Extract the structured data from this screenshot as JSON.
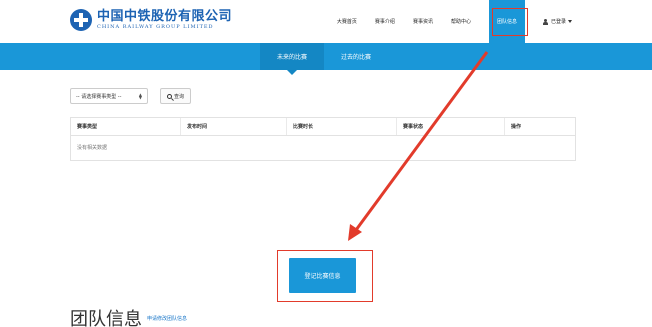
{
  "logo": {
    "cn": "中国中铁股份有限公司",
    "en": "CHINA RAILWAY GROUP LIMITED"
  },
  "nav": {
    "items": [
      {
        "label": "大赛首页"
      },
      {
        "label": "赛事介绍"
      },
      {
        "label": "赛事资讯"
      },
      {
        "label": "帮助中心"
      },
      {
        "label": "团队信息",
        "active": true
      }
    ],
    "user_label": "已登录"
  },
  "tabs": [
    {
      "label": "未来的比赛",
      "active": true
    },
    {
      "label": "过去的比赛",
      "active": false
    }
  ],
  "filter": {
    "select_value": "-- 请选择赛事类型 --",
    "search_label": "查询"
  },
  "table": {
    "columns": [
      "赛事类型",
      "发布时间",
      "比赛时长",
      "赛事状态",
      "操作"
    ],
    "empty_text": "没有相关数据"
  },
  "register_button": "登记比赛信息",
  "section": {
    "title": "团队信息",
    "link": "申请修改团队信息"
  },
  "colors": {
    "accent": "#1a97d8",
    "highlight": "#e23b2b",
    "brand": "#1d63b3"
  }
}
